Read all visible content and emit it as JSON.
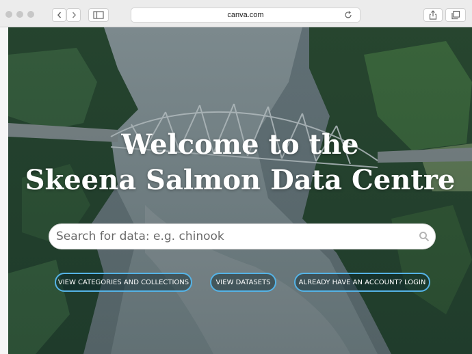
{
  "browser": {
    "url": "canva.com"
  },
  "hero": {
    "title_line1": "Welcome to the",
    "title_line2": "Skeena Salmon Data Centre"
  },
  "search": {
    "placeholder": "Search for data: e.g. chinook"
  },
  "actions": {
    "categories_label": "VIEW CATEGORIES AND COLLECTIONS",
    "datasets_label": "VIEW DATASETS",
    "login_label": "ALREADY HAVE AN ACCOUNT? LOGIN"
  },
  "colors": {
    "accent": "#55b3e6",
    "water": "#8e9aa0",
    "forest": "#2f4c34"
  },
  "icons": [
    "back-chevron-icon",
    "forward-chevron-icon",
    "sidebar-icon",
    "reload-icon",
    "share-icon",
    "tabs-icon",
    "search-icon"
  ]
}
